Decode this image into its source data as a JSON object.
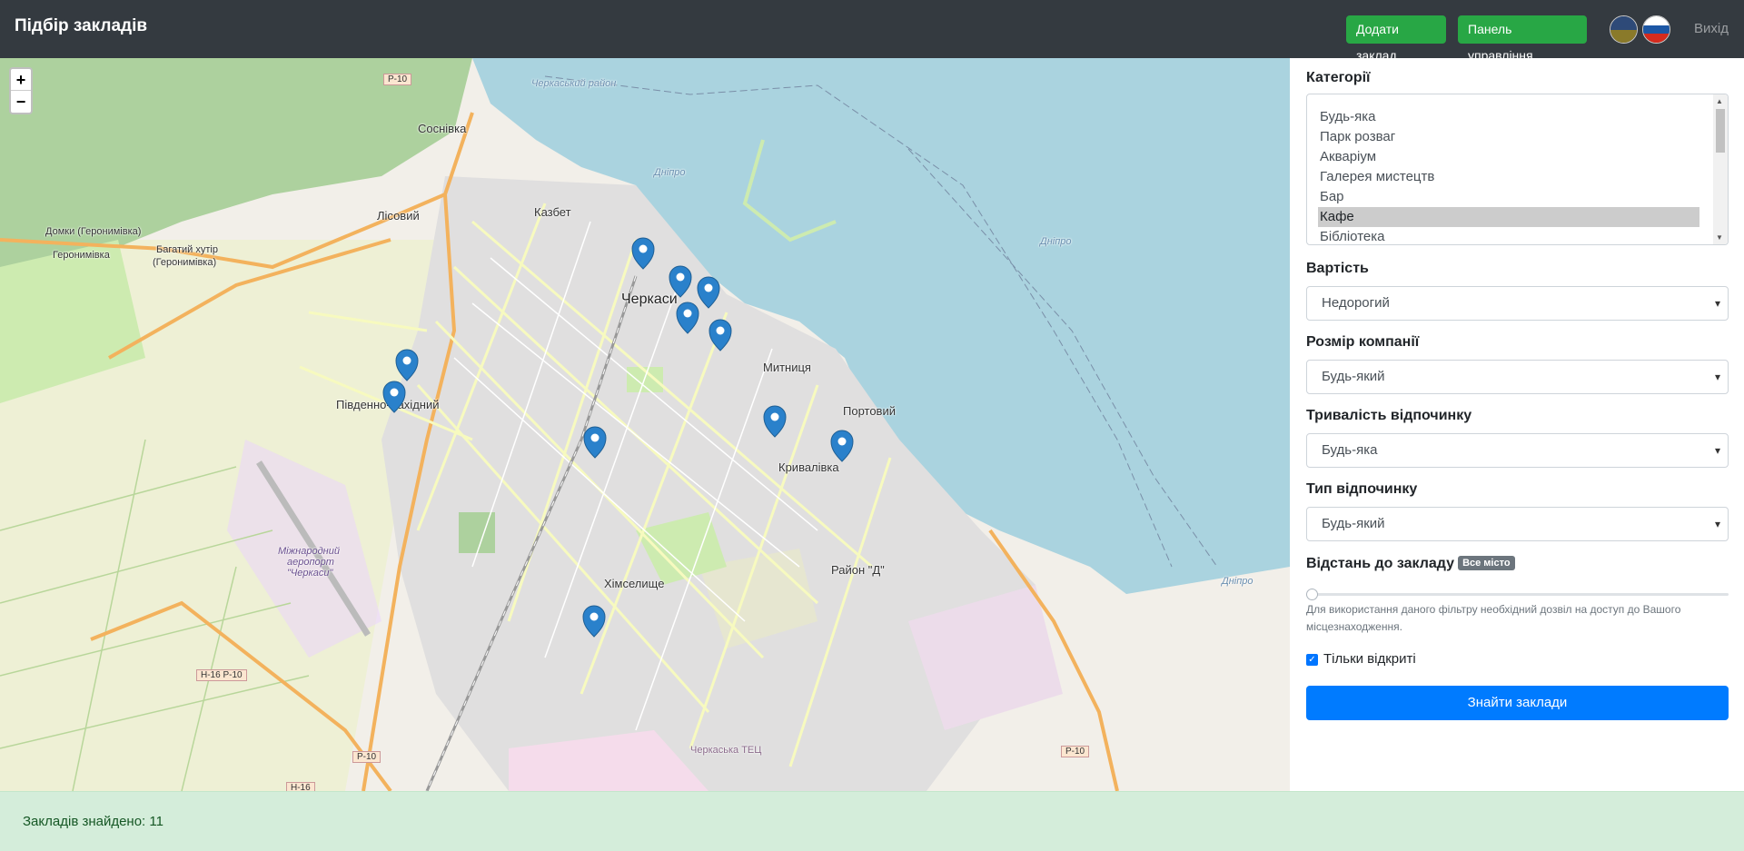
{
  "header": {
    "title": "Підбір закладів",
    "add_button": "Додати заклад",
    "panel_button": "Панель управління",
    "logout": "Вихід",
    "flags": [
      "flag-ukraine-icon",
      "flag-russia-icon"
    ]
  },
  "map": {
    "zoom_in": "+",
    "zoom_out": "−",
    "labels": {
      "sosnivka": "Соснівка",
      "lisovyi": "Лісовий",
      "kazbet": "Казбет",
      "cherkasy": "Черкаси",
      "domky": "Домки (Геронимівка)",
      "heronymivka": "Геронимівка",
      "bahatyi": "Багатий хутір",
      "bahatyi2": "(Геронимівка)",
      "mytnytsia": "Митниця",
      "pivdenno": "Південно-Західний",
      "portovyi": "Портовий",
      "kryvalivka": "Кривалівка",
      "raion_d": "Район \"Д\"",
      "khimselyshche": "Хімселище",
      "airport1": "Міжнародний",
      "airport2": "аеропорт",
      "airport3": "\"Черкаси\"",
      "dnipro1": "Дніпро",
      "dnipro2": "Дніпро",
      "dnipro3": "Дніпро",
      "tets": "Черкаська ТЕЦ",
      "cherkaskyi_raion": "Черкаський район"
    },
    "shields": {
      "p10_top": "Р-10",
      "h16_p10": "Н-16 Р-10",
      "p10_bottom": "Р-10",
      "h16": "Н-16",
      "p10_right": "Р-10"
    },
    "marker_icon": "map-pin-icon",
    "markers_count": 11
  },
  "filters": {
    "categories_label": "Категорії",
    "categories": [
      "Будь-яка",
      "Парк розваг",
      "Акваріум",
      "Галерея мистецтв",
      "Бар",
      "Кафе",
      "Бібліотека"
    ],
    "selected_category": "Кафе",
    "cost_label": "Вартість",
    "cost_value": "Недорогий",
    "company_label": "Розмір компанії",
    "company_value": "Будь-який",
    "duration_label": "Тривалість відпочинку",
    "duration_value": "Будь-яка",
    "type_label": "Тип відпочинку",
    "type_value": "Будь-який",
    "distance_label": "Відстань до закладу",
    "distance_badge": "Все місто",
    "distance_level": 0,
    "distance_hint": "Для використання даного фільтру необхідний дозвіл на доступ до Вашого місцезнаходження.",
    "open_only_label": "Тільки відкриті",
    "open_only_checked": true,
    "find_button": "Знайти заклади"
  },
  "footer": {
    "found_text": "Закладів знайдено: 11"
  },
  "colors": {
    "navbar": "#343a40",
    "green_button": "#28a745",
    "primary": "#007bff",
    "water": "#aad3df",
    "marker": "#2a81cb",
    "footer_bg": "#d4edda"
  }
}
